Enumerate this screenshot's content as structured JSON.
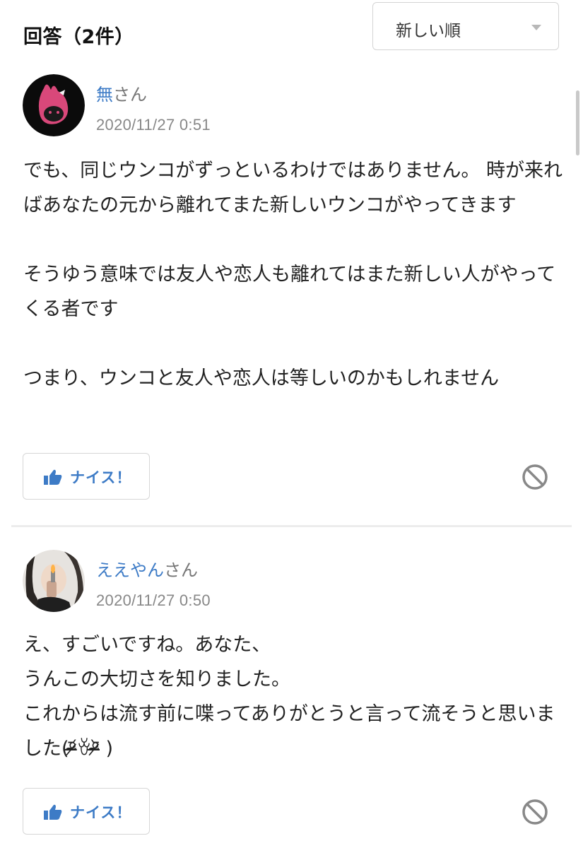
{
  "header": {
    "title": "回答（2件）",
    "sort": {
      "selected": "新しい順"
    }
  },
  "answers": [
    {
      "user_name": "無",
      "user_suffix": "さん",
      "timestamp": "2020/11/27 0:51",
      "body": "でも、同じウンコがずっといるわけではありません。 時が来ればあなたの元から離れてまた新しいウンコがやってきます\n\nそうゆう意味では友人や恋人も離れてはまた新しい人がやってくる者です\n\nつまり、ウンコと友人や恋人は等しいのかもしれません",
      "nice_label": "ナイス！"
    },
    {
      "user_name": "ええやん",
      "user_suffix": "さん",
      "timestamp": "2020/11/27 0:50",
      "body": "え、すごいですね。あなた、\nうんこの大切さを知りました。\nこれからは流す前に喋ってありがとうと言って流そうと思いました(ᵒ̴̶̷᷄ꈊᵒ̴̶̷᷅ )",
      "nice_label": "ナイス！"
    }
  ],
  "colors": {
    "accent": "#3d7bc6",
    "text": "#222222",
    "muted": "#888888",
    "border": "#d6d6d6"
  },
  "icons": {
    "like": "thumbs-up-icon",
    "report": "prohibited-icon",
    "sort": "chevron-down-icon"
  }
}
